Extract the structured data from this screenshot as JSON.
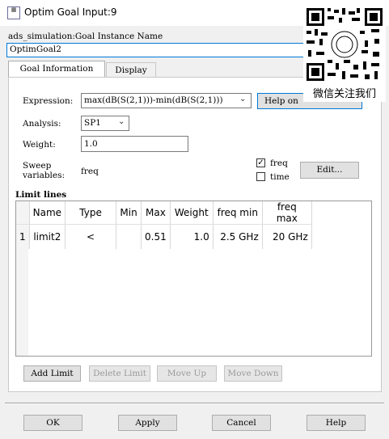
{
  "window": {
    "title": "Optim Goal Input:9"
  },
  "instance": {
    "label": "ads_simulation:Goal Instance Name",
    "name": "OptimGoal2"
  },
  "tabs": [
    {
      "label": "Goal Information"
    },
    {
      "label": "Display"
    }
  ],
  "goal": {
    "expression_label": "Expression:",
    "expression_value": "max(dB(S(2,1)))-min(dB(S(2,1)))",
    "help_on_label": "Help on",
    "analysis_label": "Analysis:",
    "analysis_value": "SP1",
    "weight_label": "Weight:",
    "weight_value": "1.0",
    "sweep_label_1": "Sweep",
    "sweep_label_2": "variables:",
    "sweep_value": "freq",
    "freq_label": "freq",
    "time_label": "time",
    "edit_label": "Edit..."
  },
  "limits": {
    "section_label": "Limit lines",
    "columns": [
      "",
      "Name",
      "Type",
      "Min",
      "Max",
      "Weight",
      "freq min",
      "freq max"
    ],
    "rows": [
      [
        "1",
        "limit2",
        "<",
        "",
        "0.51",
        "1.0",
        "2.5 GHz",
        "20 GHz"
      ]
    ],
    "add_label": "Add Limit",
    "delete_label": "Delete Limit",
    "move_up_label": "Move Up",
    "move_down_label": "Move Down"
  },
  "footer": {
    "ok": "OK",
    "apply": "Apply",
    "cancel": "Cancel",
    "help": "Help"
  },
  "overlay": {
    "caption": "微信关注我们"
  },
  "colors": {
    "selected_field_border": "#0078d7"
  }
}
